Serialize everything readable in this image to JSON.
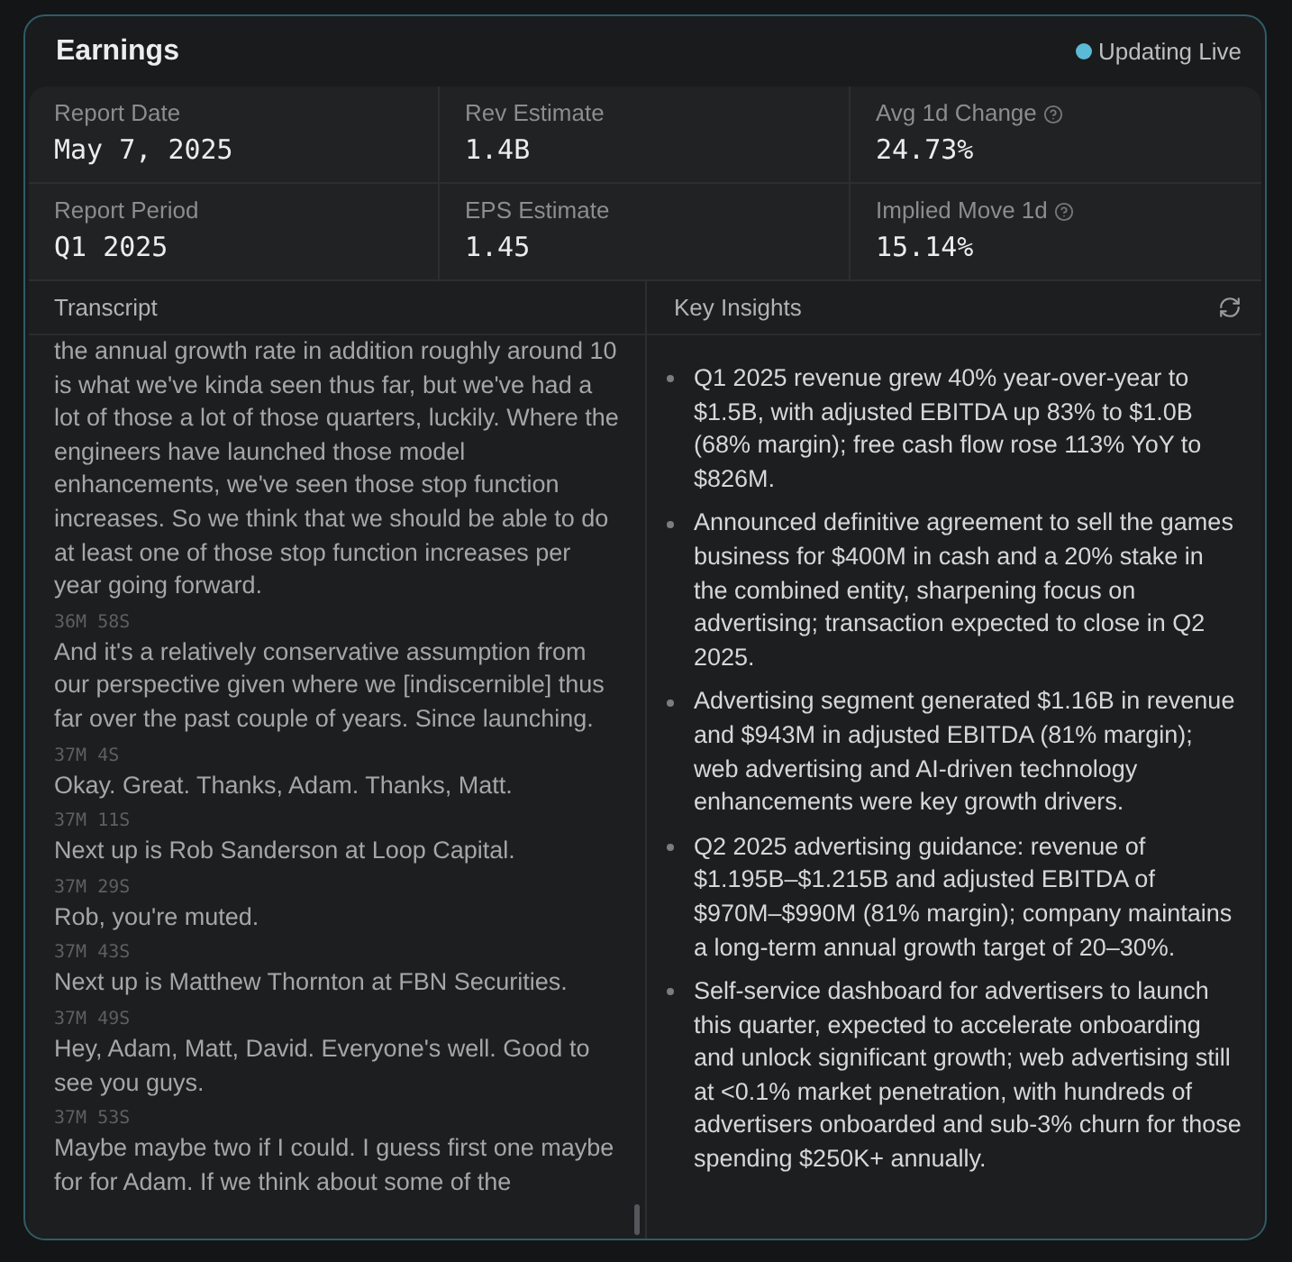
{
  "header": {
    "title": "Earnings",
    "status": {
      "label": "Updating Live",
      "live": true
    }
  },
  "stats": [
    {
      "label": "Report Date",
      "value": "May 7, 2025",
      "help": false
    },
    {
      "label": "Rev Estimate",
      "value": "1.4B",
      "help": false
    },
    {
      "label": "Avg 1d Change",
      "value": "24.73%",
      "help": true
    },
    {
      "label": "Report Period",
      "value": "Q1 2025",
      "help": false
    },
    {
      "label": "EPS Estimate",
      "value": "1.45",
      "help": false
    },
    {
      "label": "Implied Move 1d",
      "value": "15.14%",
      "help": true
    }
  ],
  "transcript": {
    "title": "Transcript",
    "entries": [
      {
        "text": "the annual growth rate in addition roughly around 10 is what we've kinda seen thus far, but we've had a lot of those a lot of those quarters, luckily. Where the engineers have launched those model enhancements, we've seen those stop function increases. So we think that we should be able to do at least one of those stop function increases per year going forward."
      },
      {
        "time": "36M 58S",
        "text": "And it's a relatively conservative assumption from our perspective given where we [indiscernible] thus far over the past couple of years. Since launching."
      },
      {
        "time": "37M 4S",
        "text": "Okay. Great. Thanks, Adam. Thanks, Matt."
      },
      {
        "time": "37M 11S",
        "text": "Next up is Rob Sanderson at Loop Capital."
      },
      {
        "time": "37M 29S",
        "text": "Rob, you're muted."
      },
      {
        "time": "37M 43S",
        "text": "Next up is Matthew Thornton at FBN Securities."
      },
      {
        "time": "37M 49S",
        "text": "Hey, Adam, Matt, David. Everyone's well. Good to see you guys."
      },
      {
        "time": "37M 53S",
        "text": "Maybe maybe two if I could. I guess first one maybe for for Adam. If we think about some of the"
      }
    ]
  },
  "insights": {
    "title": "Key Insights",
    "items": [
      "Q1 2025 revenue grew 40% year-over-year to $1.5B, with adjusted EBITDA up 83% to $1.0B (68% margin); free cash flow rose 113% YoY to $826M.",
      "Announced definitive agreement to sell the games business for $400M in cash and a 20% stake in the combined entity, sharpening focus on advertising; transaction expected to close in Q2 2025.",
      "Advertising segment generated $1.16B in revenue and $943M in adjusted EBITDA (81% margin); web advertising and AI-driven technology enhancements were key growth drivers.",
      "Q2 2025 advertising guidance: revenue of $1.195B–$1.215B and adjusted EBITDA of $970M–$990M (81% margin); company maintains a long-term annual growth target of 20–30%.",
      "Self-service dashboard for advertisers to launch this quarter, expected to accelerate onboarding and unlock significant growth; web advertising still at <0.1% market penetration, with hundreds of advertisers onboarded and sub-3% churn for those spending $250K+ annually."
    ]
  }
}
